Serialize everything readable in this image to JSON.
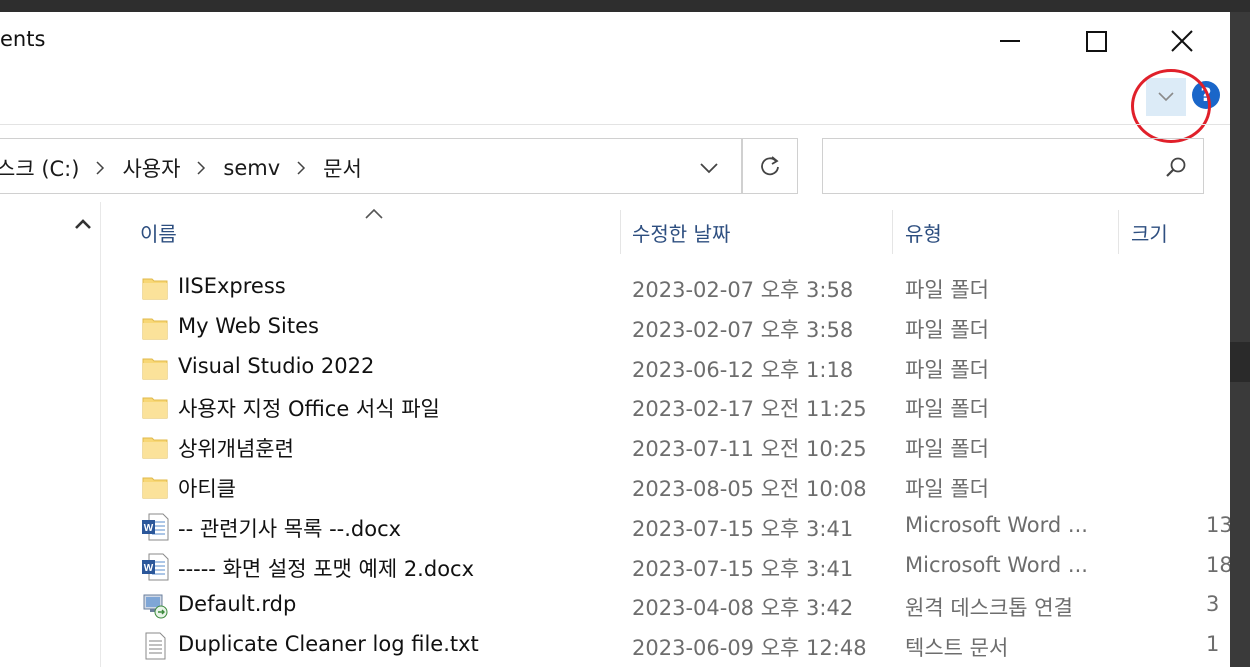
{
  "window": {
    "title": "ents"
  },
  "ribbon": {
    "expand_icon": "chevron-down-icon",
    "help_icon": "help-icon",
    "help_glyph": "?"
  },
  "address": {
    "crumbs": [
      "스크 (C:)",
      "사용자",
      "semv",
      "문서"
    ],
    "dropdown_icon": "chevron-down-icon",
    "refresh_icon": "refresh-icon"
  },
  "search": {
    "placeholder": "",
    "icon": "search-icon"
  },
  "columns": {
    "name": "이름",
    "date": "수정한 날짜",
    "type": "유형",
    "size": "크기"
  },
  "files": [
    {
      "name": "IISExpress",
      "date": "2023-02-07 오후 3:58",
      "type": "파일 폴더",
      "size": "",
      "icon": "folder-icon"
    },
    {
      "name": "My Web Sites",
      "date": "2023-02-07 오후 3:58",
      "type": "파일 폴더",
      "size": "",
      "icon": "folder-icon"
    },
    {
      "name": "Visual Studio 2022",
      "date": "2023-06-12 오후 1:18",
      "type": "파일 폴더",
      "size": "",
      "icon": "folder-icon"
    },
    {
      "name": "사용자 지정 Office 서식 파일",
      "date": "2023-02-17 오전 11:25",
      "type": "파일 폴더",
      "size": "",
      "icon": "folder-icon"
    },
    {
      "name": "상위개념훈련",
      "date": "2023-07-11 오전 10:25",
      "type": "파일 폴더",
      "size": "",
      "icon": "folder-icon"
    },
    {
      "name": "아티클",
      "date": "2023-08-05 오전 10:08",
      "type": "파일 폴더",
      "size": "",
      "icon": "folder-icon"
    },
    {
      "name": "-- 관련기사 목록 --.docx",
      "date": "2023-07-15 오후 3:41",
      "type": "Microsoft Word ...",
      "size": "13",
      "icon": "word-doc-icon"
    },
    {
      "name": "----- 화면 설정 포맷 예제 2.docx",
      "date": "2023-07-15 오후 3:41",
      "type": "Microsoft Word ...",
      "size": "18",
      "icon": "word-doc-icon"
    },
    {
      "name": "Default.rdp",
      "date": "2023-04-08 오후 3:42",
      "type": "원격 데스크톱 연결",
      "size": "3",
      "icon": "rdp-file-icon"
    },
    {
      "name": "Duplicate Cleaner log file.txt",
      "date": "2023-06-09 오후 12:48",
      "type": "텍스트 문서",
      "size": "1",
      "icon": "text-file-icon"
    }
  ],
  "colors": {
    "accent": "#1a66c9",
    "folder": "#f8d775",
    "highlight_ring": "#e0202a",
    "selection": "#cce8ff"
  }
}
